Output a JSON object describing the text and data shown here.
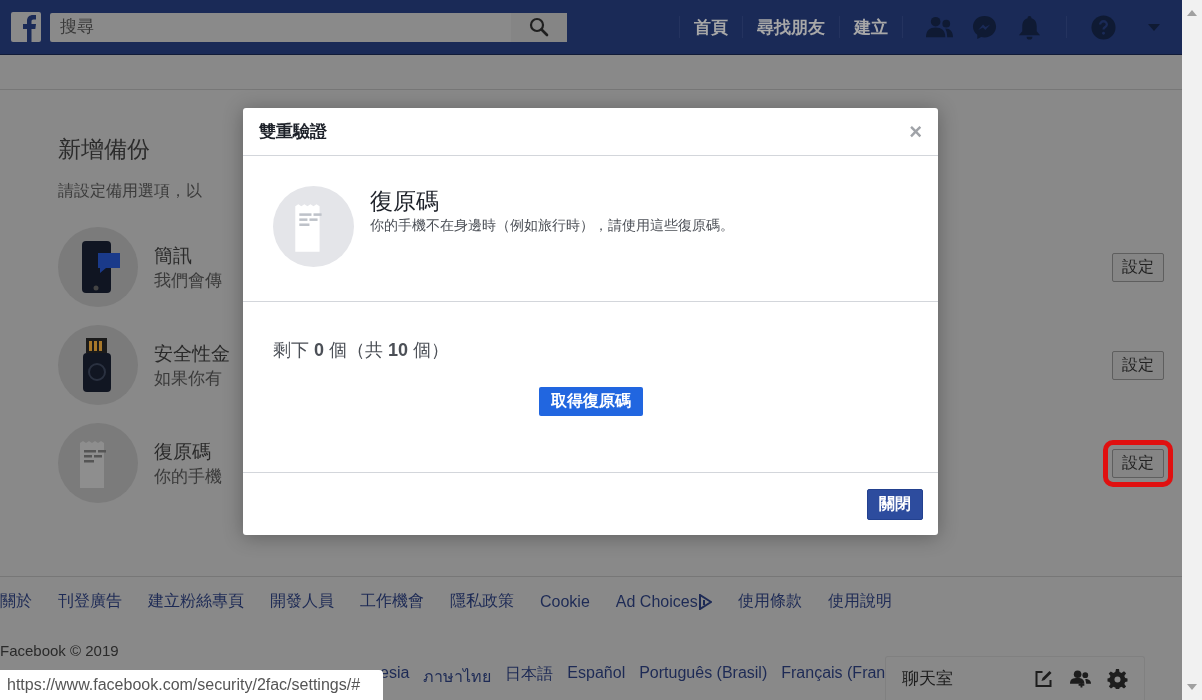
{
  "header": {
    "search": {
      "placeholder": "搜尋"
    },
    "nav": [
      "首頁",
      "尋找朋友",
      "建立"
    ]
  },
  "section": {
    "title": "新增備份",
    "subtitle": "請設定備用選項，以",
    "methods": [
      {
        "kind": "phone",
        "title": "簡訊",
        "description": "我們會傳",
        "button": "設定",
        "highlighted": false
      },
      {
        "kind": "key",
        "title": "安全性金",
        "description": "如果你有",
        "button": "設定",
        "highlighted": false
      },
      {
        "kind": "codes",
        "title": "復原碼",
        "description": "你的手機",
        "button": "設定",
        "highlighted": true
      }
    ]
  },
  "dialog": {
    "title": "雙重驗證",
    "close": "×",
    "method_title": "復原碼",
    "method_description": "你的手機不在身邊時（例如旅行時），請使用這些復原碼。",
    "remaining": "剩下 **0** 個（共 **10** 個）",
    "primary_button": "取得復原碼",
    "close_button": "關閉"
  },
  "footer": {
    "links": [
      {
        "label": "關於",
        "kind": "text"
      },
      {
        "label": "刊登廣告",
        "kind": "text"
      },
      {
        "label": "建立粉絲專頁",
        "kind": "text"
      },
      {
        "label": "開發人員",
        "kind": "text"
      },
      {
        "label": "工作機會",
        "kind": "text"
      },
      {
        "label": "隱私政策",
        "kind": "text"
      },
      {
        "label": "Cookie",
        "kind": "text"
      },
      {
        "label": "Ad Choices",
        "kind": "adchoices"
      },
      {
        "label": "使用條款",
        "kind": "text"
      },
      {
        "label": "使用說明",
        "kind": "text"
      }
    ],
    "copyright": "Facebook © 2019",
    "languages": [
      "esia",
      "ภาษาไทย",
      "日本語",
      "Español",
      "Português (Brasil)",
      "Français (Fran"
    ]
  },
  "status_url": "https://www.facebook.com/security/2fac/settings/#",
  "chat": {
    "title": "聊天室"
  }
}
